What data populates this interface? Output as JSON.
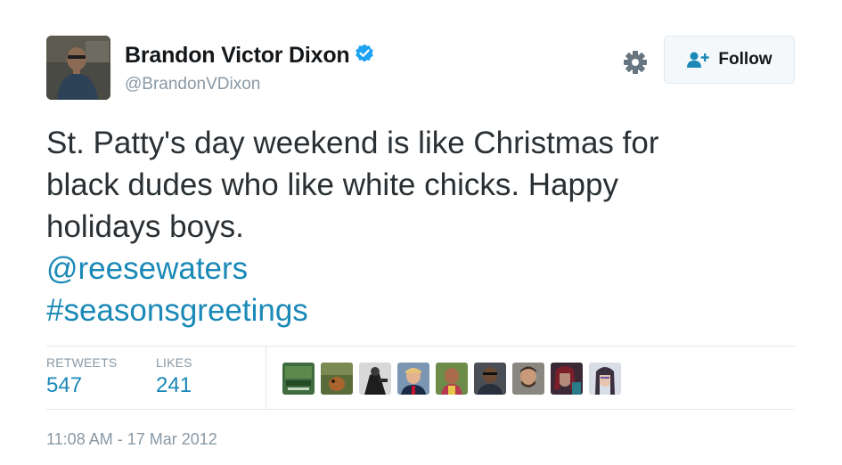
{
  "user": {
    "name": "Brandon Victor Dixon",
    "handle": "@BrandonVDixon",
    "verified": true
  },
  "actions": {
    "settings_icon": "gear-icon",
    "follow_label": "Follow",
    "follow_icon": "add-user-icon"
  },
  "tweet": {
    "line1": "St. Patty's day weekend is like Christmas for",
    "line2": "black dudes who like white chicks. Happy",
    "line3": "holidays boys.",
    "mention": "@reesewaters",
    "hashtag": "#seasonsgreetings"
  },
  "stats": {
    "retweets_label": "RETWEETS",
    "retweets_value": "547",
    "likes_label": "LIKES",
    "likes_value": "241"
  },
  "timestamp": "11:08 AM - 17 Mar 2012",
  "colors": {
    "link": "#1a89b7",
    "verified": "#1da1f2",
    "muted": "#8899a6",
    "text": "#292f33"
  }
}
